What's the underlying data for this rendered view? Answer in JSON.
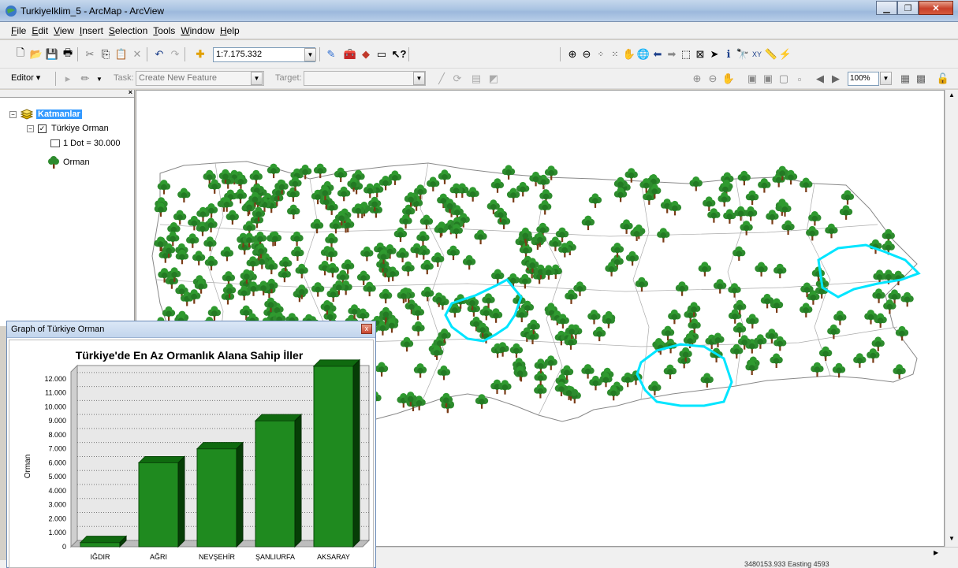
{
  "window": {
    "title": "TurkiyeIklim_5 - ArcMap - ArcView"
  },
  "menu": [
    "File",
    "Edit",
    "View",
    "Insert",
    "Selection",
    "Tools",
    "Window",
    "Help"
  ],
  "toolbar": {
    "scale": "1:7.175.332",
    "editor_label": "Editor ▾",
    "task_label": "Task:",
    "task_value": "Create New Feature",
    "target_label": "Target:",
    "zoom_value": "100%"
  },
  "toc": {
    "root_label": "Katmanlar",
    "layer_name": "Türkiye Orman",
    "legend_dot": "1 Dot = 30.000",
    "legend_symbol": "Orman"
  },
  "status": {
    "coordinates": "3480153.933 Easting 4593"
  },
  "graph_window": {
    "title": "Graph of  Türkiye Orman"
  },
  "chart_data": {
    "type": "bar",
    "title": "Türkiye'de En Az Ormanlık Alana Sahip İller",
    "ylabel": "Orman",
    "xlabel": "",
    "categories": [
      "IĞDIR",
      "AĞRI",
      "NEVŞEHİR",
      "ŞANLIURFA",
      "AKSARAY"
    ],
    "values": [
      300,
      6000,
      7000,
      9000,
      12900
    ],
    "ylim": [
      0,
      12500
    ],
    "yticks": [
      "0",
      "1.000",
      "2.000",
      "3.000",
      "4.000",
      "5.000",
      "6.000",
      "7.000",
      "8.000",
      "9.000",
      "10.000",
      "11.000",
      "12.000"
    ],
    "bar_color": "#1f8a1f",
    "grid": true
  },
  "colors": {
    "tree": "#2e8b2e",
    "trunk": "#7a3b16",
    "selection_outline": "#00e5ff",
    "selected_layer": "#3399ff"
  }
}
